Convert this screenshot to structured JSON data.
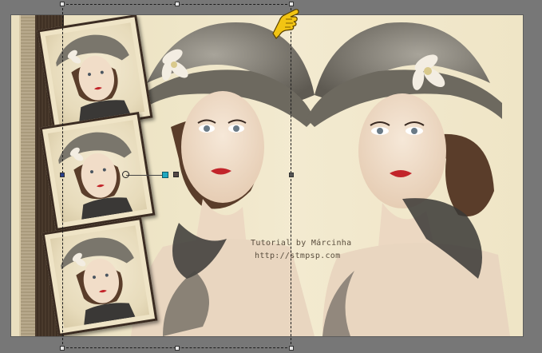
{
  "canvas": {
    "watermark_line1": "Tutorial by Márcinha",
    "watermark_line2": "http://stmpsp.com"
  },
  "colors": {
    "workspace": "#777777",
    "background_cream": "#efe6c8",
    "frame_brown": "#3b2c22",
    "stripe_dark": "#4a3a2c",
    "rotation_handle": "#20a8c0",
    "pointer_yellow": "#f2c413"
  },
  "icons": {
    "pointer": "hand-pointer-icon"
  }
}
